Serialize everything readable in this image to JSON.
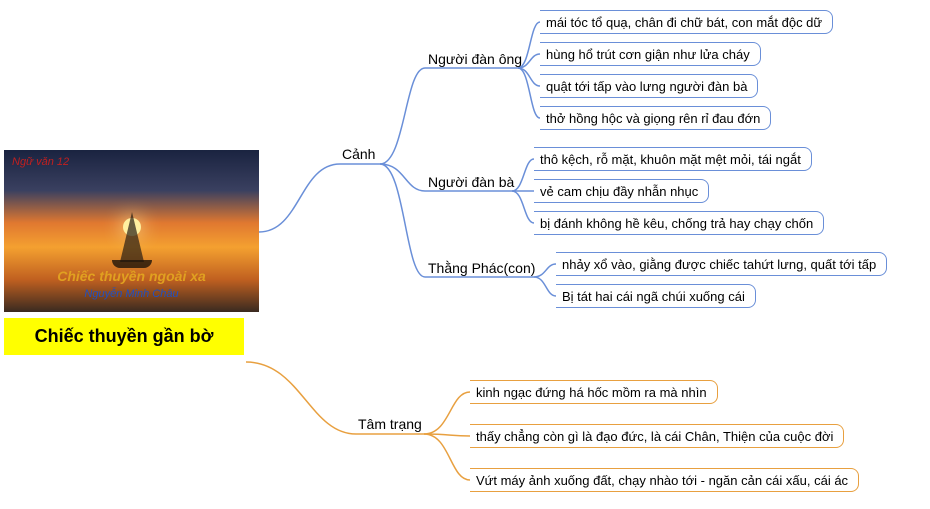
{
  "image": {
    "topleft": "Ngữ văn 12",
    "title": "Chiếc thuyền ngoài xa",
    "subtitle": "Nguyễn Minh Châu"
  },
  "root_title": "Chiếc thuyền gần bờ",
  "branches": {
    "canh": {
      "label": "Cảnh",
      "children": {
        "ong": {
          "label": "Người đàn ông",
          "leaves": [
            "mái tóc tổ quạ, chân đi chữ bát, con mắt độc dữ",
            "hùng hổ trút cơn giận như lửa cháy",
            "quật tới tấp vào lưng người đàn bà",
            "thở hồng hộc và giọng rên rỉ đau đớn"
          ]
        },
        "ba": {
          "label": "Người đàn bà",
          "leaves": [
            "thô kệch, rỗ mặt, khuôn mặt mệt mỏi, tái ngắt",
            "vẻ cam chịu đầy nhẫn nhục",
            "bị đánh không hề kêu, chống trả hay chạy chốn"
          ]
        },
        "phac": {
          "label": "Thằng Phác(con)",
          "leaves": [
            "nhảy xổ vào, giằng được chiếc tahứt lưng, quất tới tấp",
            "Bị tát hai cái ngã chúi xuống cái"
          ]
        }
      }
    },
    "tamtrang": {
      "label": "Tâm trạng",
      "leaves": [
        "kinh ngạc đứng há hốc mồm ra mà nhìn",
        "thấy chẳng còn gì là đạo đức, là cái Chân, Thiện của cuộc đời",
        "Vứt máy ảnh xuống đất, chạy nhào tới - ngăn cản cái xấu, cái ác"
      ]
    }
  }
}
